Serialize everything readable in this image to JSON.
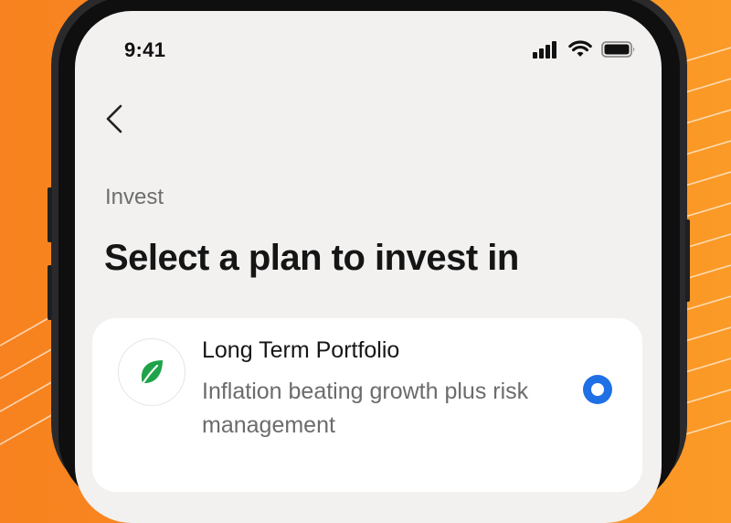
{
  "status_bar": {
    "time": "9:41"
  },
  "page": {
    "breadcrumb": "Invest",
    "title": "Select a plan to invest in"
  },
  "plans": [
    {
      "name": "Long Term Portfolio",
      "description": "Inflation beating growth plus risk management",
      "icon": "leaf-icon",
      "selected": true
    }
  ],
  "colors": {
    "background": "#f7821f",
    "accent": "#1f6fe5",
    "leaf": "#1fa34a"
  }
}
